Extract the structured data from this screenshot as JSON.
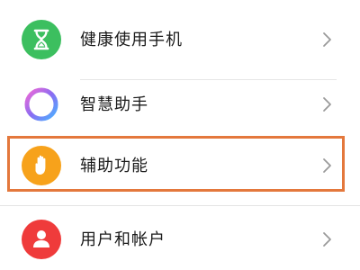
{
  "settings": {
    "items": [
      {
        "label": "健康使用手机",
        "icon": "hourglass-icon",
        "icon_color": "#3cbf5f"
      },
      {
        "label": "智慧助手",
        "icon": "assistant-ring-icon",
        "icon_color": "#8a6cf2"
      },
      {
        "label": "辅助功能",
        "icon": "hand-icon",
        "icon_color": "#f7a21b"
      },
      {
        "label": "用户和帐户",
        "icon": "user-icon",
        "icon_color": "#ef3b3b"
      }
    ]
  },
  "highlight": {
    "target": "辅助功能",
    "color": "#e4783c"
  }
}
